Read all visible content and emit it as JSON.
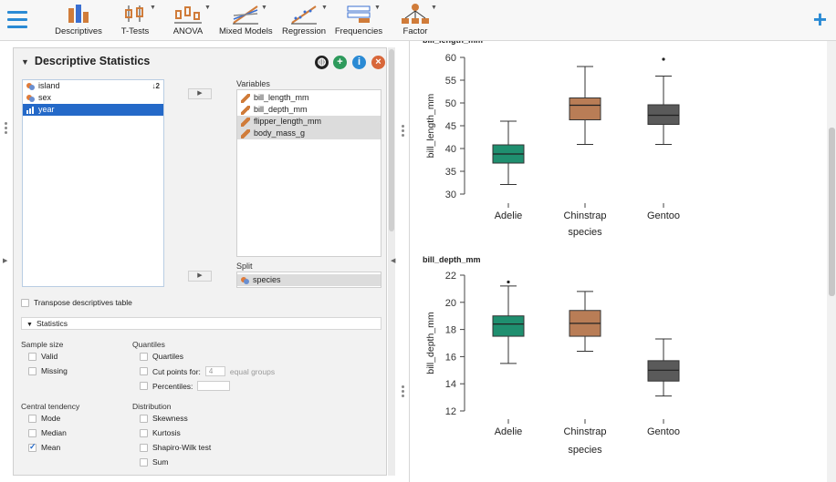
{
  "toolbar": {
    "items": [
      {
        "label": "Descriptives",
        "icon": "descriptives-icon"
      },
      {
        "label": "T-Tests",
        "icon": "ttests-icon"
      },
      {
        "label": "ANOVA",
        "icon": "anova-icon"
      },
      {
        "label": "Mixed Models",
        "icon": "mixed-models-icon"
      },
      {
        "label": "Regression",
        "icon": "regression-icon"
      },
      {
        "label": "Frequencies",
        "icon": "frequencies-icon"
      },
      {
        "label": "Factor",
        "icon": "factor-icon"
      }
    ],
    "plus": "+"
  },
  "panel": {
    "title": "Descriptive Statistics",
    "available_vars": [
      {
        "name": "island",
        "type": "nominal"
      },
      {
        "name": "sex",
        "type": "nominal"
      },
      {
        "name": "year",
        "type": "ordinal",
        "selected": true
      }
    ],
    "variables_label": "Variables",
    "variables": [
      {
        "name": "bill_length_mm",
        "highlight": false
      },
      {
        "name": "bill_depth_mm",
        "highlight": false
      },
      {
        "name": "flipper_length_mm",
        "highlight": true
      },
      {
        "name": "body_mass_g",
        "highlight": true
      }
    ],
    "split_label": "Split",
    "split_var": "species",
    "transpose_label": "Transpose descriptives table",
    "statistics_section": "Statistics",
    "sample_size": {
      "heading": "Sample size",
      "valid": "Valid",
      "missing": "Missing"
    },
    "quantiles": {
      "heading": "Quantiles",
      "quartiles": "Quartiles",
      "cut_points": "Cut points for:",
      "cut_value": "4",
      "equal_groups": "equal groups",
      "percentiles": "Percentiles:"
    },
    "central": {
      "heading": "Central tendency",
      "mode": "Mode",
      "median": "Median",
      "mean": "Mean"
    },
    "distribution": {
      "heading": "Distribution",
      "skewness": "Skewness",
      "kurtosis": "Kurtosis",
      "shapiro": "Shapiro-Wilk test",
      "sum": "Sum"
    }
  },
  "colors": {
    "adelie": "#1f8f6f",
    "chinstrap": "#b97d56",
    "gentoo": "#5a5a5a",
    "accent": "#2a8ad4"
  },
  "chart_data": [
    {
      "type": "box",
      "title": "bill_length_mm",
      "ylabel": "bill_length_mm",
      "xlabel": "species",
      "categories": [
        "Adelie",
        "Chinstrap",
        "Gentoo"
      ],
      "ylim": [
        30,
        60
      ],
      "yticks": [
        30,
        35,
        40,
        45,
        50,
        55,
        60
      ],
      "boxes": [
        {
          "min": 32.1,
          "q1": 36.8,
          "median": 38.8,
          "q3": 40.8,
          "max": 46.0,
          "outliers": []
        },
        {
          "min": 40.9,
          "q1": 46.3,
          "median": 49.5,
          "q3": 51.1,
          "max": 58.0,
          "outliers": []
        },
        {
          "min": 40.9,
          "q1": 45.3,
          "median": 47.3,
          "q3": 49.6,
          "max": 55.9,
          "outliers": [
            59.6
          ]
        }
      ]
    },
    {
      "type": "box",
      "title": "bill_depth_mm",
      "ylabel": "bill_depth_mm",
      "xlabel": "species",
      "categories": [
        "Adelie",
        "Chinstrap",
        "Gentoo"
      ],
      "ylim": [
        12,
        22
      ],
      "yticks": [
        12,
        14,
        16,
        18,
        20,
        22
      ],
      "boxes": [
        {
          "min": 15.5,
          "q1": 17.5,
          "median": 18.4,
          "q3": 19.0,
          "max": 21.2,
          "outliers": [
            21.5
          ]
        },
        {
          "min": 16.4,
          "q1": 17.5,
          "median": 18.45,
          "q3": 19.4,
          "max": 20.8,
          "outliers": []
        },
        {
          "min": 13.1,
          "q1": 14.2,
          "median": 15.0,
          "q3": 15.7,
          "max": 17.3,
          "outliers": []
        }
      ]
    }
  ]
}
